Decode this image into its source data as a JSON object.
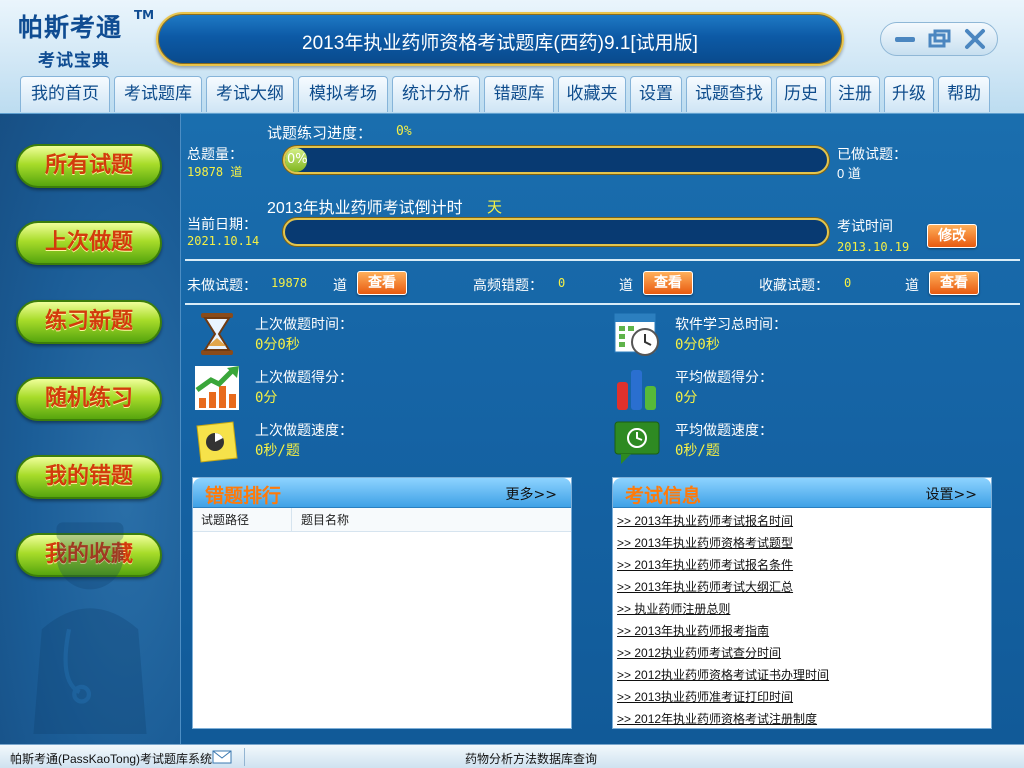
{
  "header": {
    "logo_main": "帕斯考通",
    "logo_tm": "TM",
    "logo_sub": "考试宝典",
    "title": "2013年执业药师资格考试题库(西药)9.1[试用版]",
    "window_controls": [
      "minimize-icon",
      "restore-icon",
      "close-icon"
    ]
  },
  "nav": {
    "tabs": [
      "我的首页",
      "考试题库",
      "考试大纲",
      "模拟考场",
      "统计分析",
      "错题库",
      "收藏夹",
      "设置",
      "试题查找",
      "历史",
      "注册",
      "升级",
      "帮助"
    ]
  },
  "sidebar": {
    "buttons": [
      "所有试题",
      "上次做题",
      "练习新题",
      "随机练习",
      "我的错题",
      "我的收藏"
    ]
  },
  "progress": {
    "title": "试题练习进度：",
    "percent_text": "0%",
    "percent_value": 0,
    "bar_label": "0%",
    "total_label": "总题量：",
    "total_value": "19878 道",
    "done_label": "已做试题：",
    "done_value": "0 道"
  },
  "countdown": {
    "title": "2013年执业药师考试倒计时",
    "days_unit": "天",
    "date_label": "当前日期：",
    "date_value": "2021.10.14",
    "exam_label": "考试时间",
    "exam_value": "2013.10.19",
    "modify_button": "修改"
  },
  "counts": {
    "undone_label": "未做试题：",
    "undone_value": "19878",
    "undone_unit": "道",
    "frequent_wrong_label": "高频错题：",
    "frequent_wrong_value": "0",
    "frequent_wrong_unit": "道",
    "fav_label": "收藏试题：",
    "fav_value": "0",
    "fav_unit": "道",
    "view_button": "查看"
  },
  "stats": {
    "last_time_label": "上次做题时间：",
    "last_time_value": "0分0秒",
    "total_time_label": "软件学习总时间：",
    "total_time_value": "0分0秒",
    "last_score_label": "上次做题得分：",
    "last_score_value": "0分",
    "avg_score_label": "平均做题得分：",
    "avg_score_value": "0分",
    "last_speed_label": "上次做题速度：",
    "last_speed_value": "0秒/题",
    "avg_speed_label": "平均做题速度：",
    "avg_speed_value": "0秒/题"
  },
  "wrong_panel": {
    "title": "错题排行",
    "more": "更多>>",
    "columns": [
      "试题路径",
      "题目名称"
    ]
  },
  "exam_panel": {
    "title": "考试信息",
    "more": "设置>>",
    "links": [
      ">> 2013年执业药师考试报名时间",
      ">> 2013年执业药师资格考试题型",
      ">> 2013年执业药师考试报名条件",
      ">> 2013年执业药师考试大纲汇总",
      ">> 执业药师注册总则",
      ">> 2013年执业药师报考指南",
      ">> 2012执业药师考试查分时间",
      ">> 2012执业药师资格考试证书办理时间",
      ">> 2013执业药师准考证打印时间",
      ">> 2012年执业药师资格考试注册制度"
    ]
  },
  "status_bar": {
    "app_name": "帕斯考通(PassKaoTong)考试题库系统",
    "mail_icon": "mail-icon",
    "center_text": "药物分析方法数据库查询"
  },
  "colors": {
    "accent_blue": "#1563a4",
    "gold_border": "#e3c54d",
    "button_green": "#a8dc2a",
    "button_text_red": "#d23b0c",
    "value_yellow": "#f5f046",
    "view_orange": "#e85a10"
  }
}
